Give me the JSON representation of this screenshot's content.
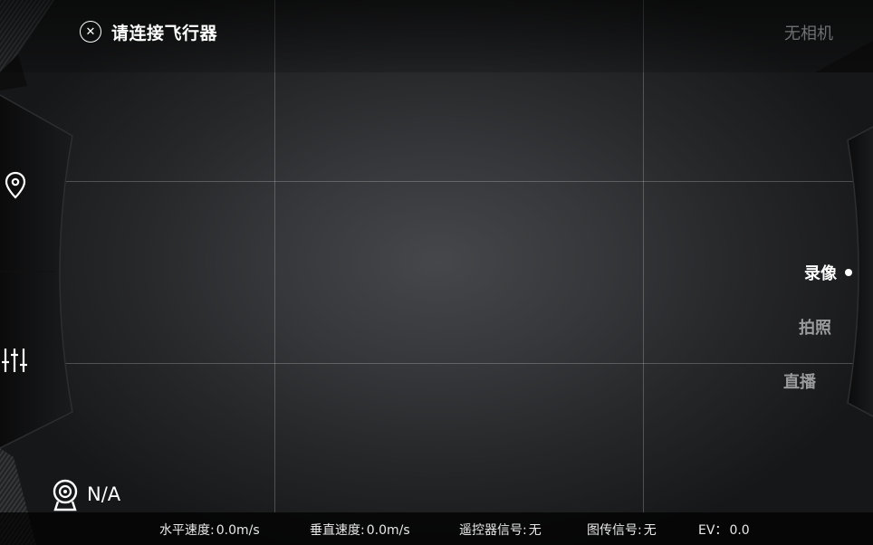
{
  "header": {
    "close_icon": "close-circle-icon",
    "connect_label": "请连接飞行器",
    "camera_status": "无相机"
  },
  "modes": {
    "video": "录像",
    "photo": "拍照",
    "live": "直播",
    "selected": "录像"
  },
  "left_tools": {
    "map_icon": "map-pin-icon",
    "adjust_icon": "adjust-sliders-icon"
  },
  "camera_info": {
    "icon": "webcam-icon",
    "value": "N/A"
  },
  "telemetry": {
    "h_speed_label": "水平速度:",
    "h_speed_value": "0.0m/s",
    "v_speed_label": "垂直速度:",
    "v_speed_value": "0.0m/s",
    "rc_signal_label": "遥控器信号:",
    "rc_signal_value": "无",
    "video_signal_label": "图传信号:",
    "video_signal_value": "无",
    "ev_label": "EV：",
    "ev_value": "0.0"
  },
  "colors": {
    "text_primary": "#ffffff",
    "text_muted": "#9a9b9d",
    "text_disabled": "#6e6f72",
    "bar_background": "#000000"
  }
}
